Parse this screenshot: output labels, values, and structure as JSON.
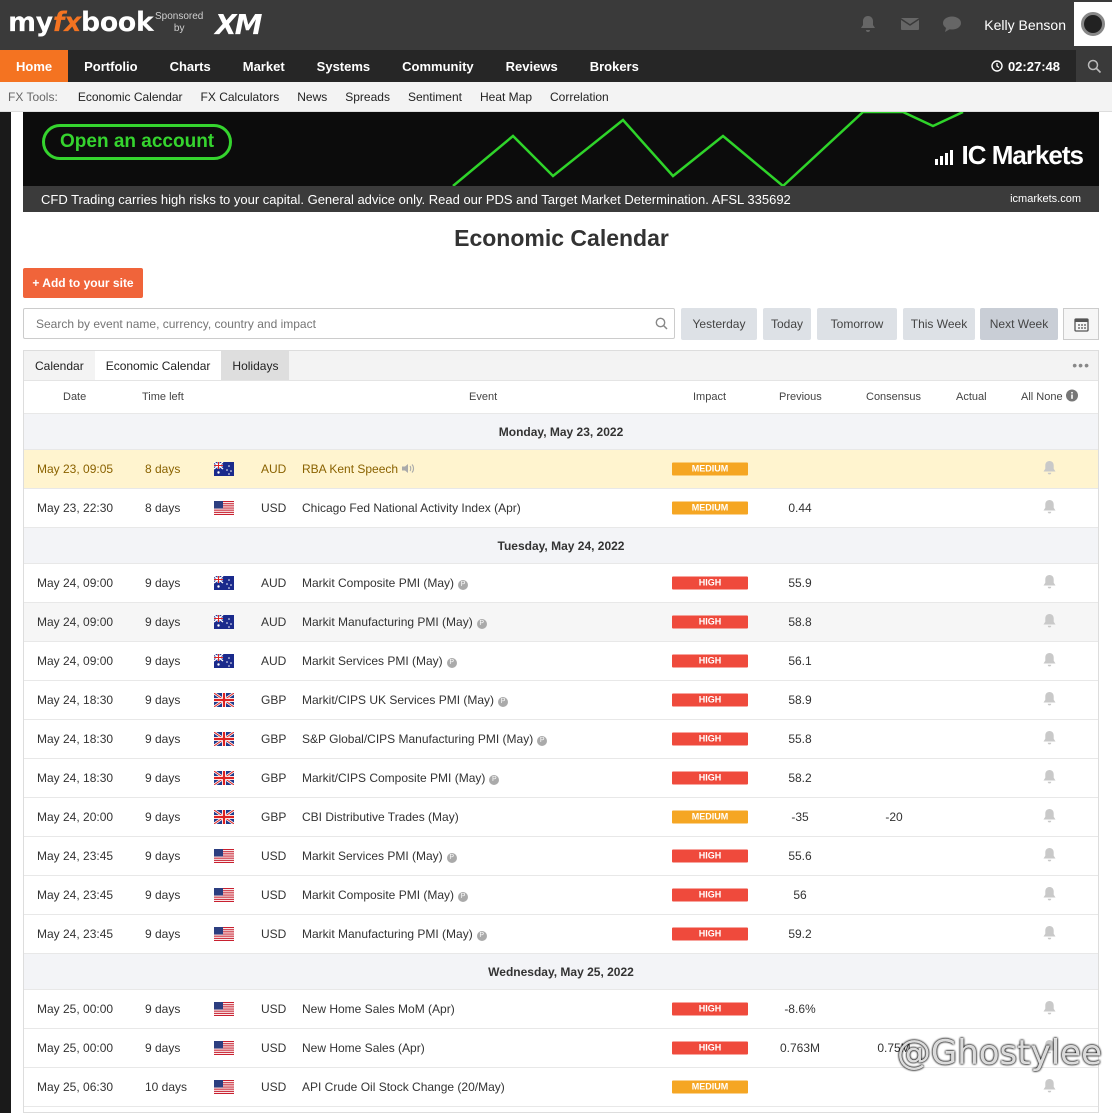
{
  "header": {
    "logo_prefix": "my",
    "logo_fx": "fx",
    "logo_suffix": "book",
    "sponsor_line1": "Sponsored",
    "sponsor_line2": "by",
    "sponsor_brand": "XM",
    "username": "Kelly Benson"
  },
  "nav": {
    "items": [
      "Home",
      "Portfolio",
      "Charts",
      "Market",
      "Systems",
      "Community",
      "Reviews",
      "Brokers"
    ],
    "active": "Home",
    "clock": "02:27:48"
  },
  "tools": {
    "label": "FX Tools:",
    "links": [
      "Economic Calendar",
      "FX Calculators",
      "News",
      "Spreads",
      "Sentiment",
      "Heat Map",
      "Correlation"
    ]
  },
  "banner": {
    "cta": "Open an account",
    "brand": "IC Markets",
    "disclaimer": "CFD Trading carries high risks to your capital. General advice only. Read our PDS and Target Market Determination. AFSL 335692",
    "site": "icmarkets.com"
  },
  "page": {
    "title": "Economic Calendar",
    "add_button": "+ Add to your site",
    "search_placeholder": "Search by event name, currency, country and impact",
    "ranges": [
      "Yesterday",
      "Today",
      "Tomorrow",
      "This Week",
      "Next Week"
    ],
    "active_range": "Next Week"
  },
  "tabs": [
    "Calendar",
    "Economic Calendar",
    "Holidays"
  ],
  "columns": {
    "date": "Date",
    "time_left": "Time left",
    "event": "Event",
    "impact": "Impact",
    "previous": "Previous",
    "consensus": "Consensus",
    "actual": "Actual",
    "all_none": "All None"
  },
  "colors": {
    "accent": "#f47321",
    "high": "#ef4a3c",
    "medium": "#f5a623",
    "highlight": "#fff4cf"
  },
  "days": [
    {
      "label": "Monday, May 23, 2022",
      "rows": [
        {
          "date": "May 23, 09:05",
          "left": "8 days",
          "flag": "AU",
          "cur": "AUD",
          "event": "RBA Kent Speech",
          "icon": "speaker",
          "impact": "MEDIUM",
          "prev": "",
          "cons": "",
          "style": "highlight"
        },
        {
          "date": "May 23, 22:30",
          "left": "8 days",
          "flag": "US",
          "cur": "USD",
          "event": "Chicago Fed National Activity Index (Apr)",
          "icon": "",
          "impact": "MEDIUM",
          "prev": "0.44",
          "cons": "",
          "style": ""
        }
      ]
    },
    {
      "label": "Tuesday, May 24, 2022",
      "rows": [
        {
          "date": "May 24, 09:00",
          "left": "9 days",
          "flag": "AU",
          "cur": "AUD",
          "event": "Markit Composite PMI (May)",
          "icon": "P",
          "impact": "HIGH",
          "prev": "55.9",
          "cons": "",
          "style": ""
        },
        {
          "date": "May 24, 09:00",
          "left": "9 days",
          "flag": "AU",
          "cur": "AUD",
          "event": "Markit Manufacturing PMI (May)",
          "icon": "P",
          "impact": "HIGH",
          "prev": "58.8",
          "cons": "",
          "style": "shade"
        },
        {
          "date": "May 24, 09:00",
          "left": "9 days",
          "flag": "AU",
          "cur": "AUD",
          "event": "Markit Services PMI (May)",
          "icon": "P",
          "impact": "HIGH",
          "prev": "56.1",
          "cons": "",
          "style": ""
        },
        {
          "date": "May 24, 18:30",
          "left": "9 days",
          "flag": "GB",
          "cur": "GBP",
          "event": "Markit/CIPS UK Services PMI (May)",
          "icon": "P",
          "impact": "HIGH",
          "prev": "58.9",
          "cons": "",
          "style": ""
        },
        {
          "date": "May 24, 18:30",
          "left": "9 days",
          "flag": "GB",
          "cur": "GBP",
          "event": "S&P Global/CIPS Manufacturing PMI (May)",
          "icon": "P",
          "impact": "HIGH",
          "prev": "55.8",
          "cons": "",
          "style": ""
        },
        {
          "date": "May 24, 18:30",
          "left": "9 days",
          "flag": "GB",
          "cur": "GBP",
          "event": "Markit/CIPS Composite PMI (May)",
          "icon": "P",
          "impact": "HIGH",
          "prev": "58.2",
          "cons": "",
          "style": ""
        },
        {
          "date": "May 24, 20:00",
          "left": "9 days",
          "flag": "GB",
          "cur": "GBP",
          "event": "CBI Distributive Trades (May)",
          "icon": "",
          "impact": "MEDIUM",
          "prev": "-35",
          "cons": "-20",
          "style": ""
        },
        {
          "date": "May 24, 23:45",
          "left": "9 days",
          "flag": "US",
          "cur": "USD",
          "event": "Markit Services PMI (May)",
          "icon": "P",
          "impact": "HIGH",
          "prev": "55.6",
          "cons": "",
          "style": ""
        },
        {
          "date": "May 24, 23:45",
          "left": "9 days",
          "flag": "US",
          "cur": "USD",
          "event": "Markit Composite PMI (May)",
          "icon": "P",
          "impact": "HIGH",
          "prev": "56",
          "cons": "",
          "style": ""
        },
        {
          "date": "May 24, 23:45",
          "left": "9 days",
          "flag": "US",
          "cur": "USD",
          "event": "Markit Manufacturing PMI (May)",
          "icon": "P",
          "impact": "HIGH",
          "prev": "59.2",
          "cons": "",
          "style": ""
        }
      ]
    },
    {
      "label": "Wednesday, May 25, 2022",
      "rows": [
        {
          "date": "May 25, 00:00",
          "left": "9 days",
          "flag": "US",
          "cur": "USD",
          "event": "New Home Sales MoM (Apr)",
          "icon": "",
          "impact": "HIGH",
          "prev": "-8.6%",
          "cons": "",
          "style": ""
        },
        {
          "date": "May 25, 00:00",
          "left": "9 days",
          "flag": "US",
          "cur": "USD",
          "event": "New Home Sales (Apr)",
          "icon": "",
          "impact": "HIGH",
          "prev": "0.763M",
          "cons": "0.75M",
          "style": ""
        },
        {
          "date": "May 25, 06:30",
          "left": "10 days",
          "flag": "US",
          "cur": "USD",
          "event": "API Crude Oil Stock Change (20/May)",
          "icon": "",
          "impact": "MEDIUM",
          "prev": "",
          "cons": "",
          "style": ""
        }
      ]
    }
  ],
  "watermark": "@Ghostylee"
}
